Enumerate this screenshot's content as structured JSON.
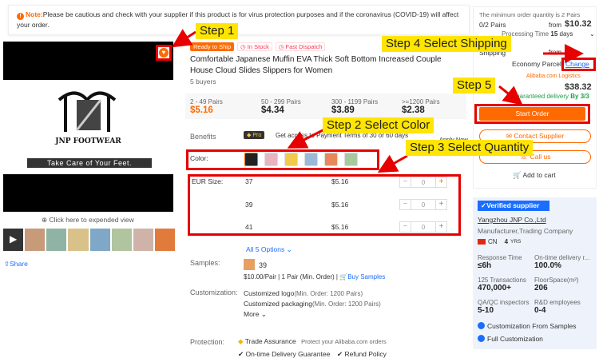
{
  "notice": {
    "label": "Note:",
    "text": "Please be cautious and check with your supplier if this product is for virus protection purposes and if the coronavirus (COVID-19) will affect your order."
  },
  "gallery": {
    "brand_name": "JNP FOOTWEAR",
    "brand_tagline": "Take Care of Your Feet.",
    "expand_label": "Click here to expended view",
    "share_label": "Share"
  },
  "product": {
    "ready_tag": "Ready to Ship",
    "instock_tag": "In Stock",
    "dispatch_tag": "Fast Dispatch",
    "title": "Comfortable Japanese Muffin EVA Thick Soft Bottom Increased Couple House Cloud Slides Slippers for Women",
    "buyers": "5 buyers",
    "price_tiers": [
      {
        "range": "2 - 49 Pairs",
        "price": "$5.16"
      },
      {
        "range": "50 - 299 Pairs",
        "price": "$4.34"
      },
      {
        "range": "300 - 1199 Pairs",
        "price": "$3.89"
      },
      {
        "range": ">=1200 Pairs",
        "price": "$2.38"
      }
    ],
    "benefits_label": "Benefits",
    "benefits_badge": "Pro",
    "benefits_text": "Get access to Payment Terms of 30 or 60 days",
    "apply_label": "Apply Now",
    "color_label": "Color:",
    "size_label": "EUR Size:",
    "sizes": [
      {
        "size": "37",
        "price": "$5.16",
        "qty": "0"
      },
      {
        "size": "39",
        "price": "$5.16",
        "qty": "0"
      },
      {
        "size": "41",
        "price": "$5.16",
        "qty": "0"
      }
    ],
    "all_options": "All 5 Options",
    "samples_label": "Samples:",
    "sample_count": "39",
    "sample_price": "$10.00/Pair",
    "sample_min": "1 Pair (Min. Order)",
    "buy_samples": "Buy Samples",
    "customization_label": "Customization:",
    "custom_items": [
      {
        "name": "Customized logo",
        "min": "(Min. Order: 1200 Pairs)"
      },
      {
        "name": "Customized packaging",
        "min": "(Min. Order: 1200 Pairs)"
      }
    ],
    "more_label": "More",
    "protection_label": "Protection:",
    "trade_assurance": "Trade Assurance",
    "trade_note": "Protect your Alibaba.com orders",
    "ontime": "On-time Delivery Guarantee",
    "refund": "Refund Policy"
  },
  "order_panel": {
    "min_order_note": "The minimum order quantity is 2 Pairs",
    "qty_selected": "0/2 Pairs",
    "from_label": "from",
    "price_1": "$10.32",
    "processing": "Processing Time",
    "processing_days": "15",
    "processing_unit": "days",
    "shipping_label": "Shipping",
    "price_2": "$2",
    "economy": "Economy Parcel",
    "change": "Change",
    "logistics": "Alibaba.com Logistics",
    "total_price": "$38.32",
    "guarantee": "Guaranteed delivery",
    "guarantee_date": "By 3/3",
    "start_order": "Start Order",
    "contact": "Contact Supplier",
    "call": "Call us",
    "add_cart": "Add to cart"
  },
  "supplier": {
    "verified": "Verified supplier",
    "name": "Yangzhou JNP Co.,Ltd",
    "type": "Manufacturer,Trading Company",
    "country": "CN",
    "years": "4",
    "years_unit": "YRS",
    "stats": [
      {
        "label": "Response Time",
        "value": "≤6h"
      },
      {
        "label": "On-time delivery r...",
        "value": "100.0%"
      },
      {
        "label": "125 Transactions",
        "value": "470,000+"
      },
      {
        "label": "FloorSpace(m²)",
        "value": "206"
      },
      {
        "label": "QA/QC inspectors",
        "value": "5-10"
      },
      {
        "label": "R&D employees",
        "value": "0-4"
      }
    ],
    "features": [
      "Customization From Samples",
      "Full Customization"
    ]
  },
  "steps": {
    "step1": "Step 1",
    "step2": "Step 2 Select Color",
    "step3": "Step 3 Select Quantity",
    "step4": "Step 4 Select Shipping",
    "step5": "Step 5"
  },
  "colors": {
    "accent": "#ff6a00",
    "annotation_red": "#e60000",
    "step_yellow": "#ffe500",
    "verified_blue": "#1a6dff"
  }
}
